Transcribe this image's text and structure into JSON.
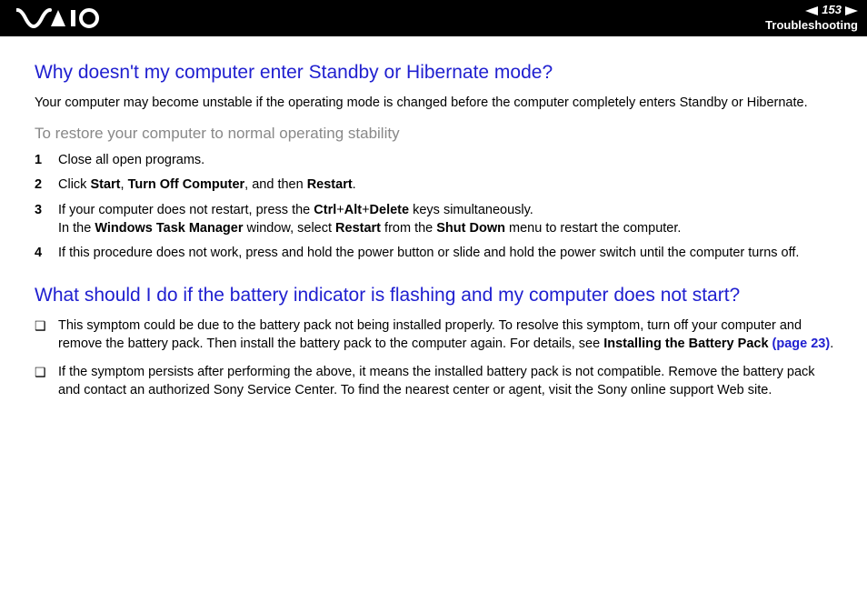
{
  "header": {
    "page_number": "153",
    "section": "Troubleshooting"
  },
  "q1": {
    "heading": "Why doesn't my computer enter Standby or Hibernate mode?",
    "intro": "Your computer may become unstable if the operating mode is changed before the computer completely enters Standby or Hibernate.",
    "sub": "To restore your computer to normal operating stability",
    "steps": {
      "s1": "Close all open programs.",
      "s2_a": "Click ",
      "s2_b": "Start",
      "s2_c": ", ",
      "s2_d": "Turn Off Computer",
      "s2_e": ", and then ",
      "s2_f": "Restart",
      "s2_g": ".",
      "s3_a": "If your computer does not restart, press the ",
      "s3_b": "Ctrl",
      "s3_c": "+",
      "s3_d": "Alt",
      "s3_e": "+",
      "s3_f": "Delete",
      "s3_g": " keys simultaneously.",
      "s3_h": "In the ",
      "s3_i": "Windows Task Manager",
      "s3_j": " window, select ",
      "s3_k": "Restart",
      "s3_l": " from the ",
      "s3_m": "Shut Down",
      "s3_n": " menu to restart the computer.",
      "s4": "If this procedure does not work, press and hold the power button or slide and hold the power switch until the computer turns off."
    }
  },
  "q2": {
    "heading": "What should I do if the battery indicator is flashing and my computer does not start?",
    "b1_a": "This symptom could be due to the battery pack not being installed properly. To resolve this symptom, turn off your computer and remove the battery pack. Then install the battery pack to the computer again. For details, see ",
    "b1_b": "Installing the Battery Pack ",
    "b1_c": "(page 23)",
    "b1_d": ".",
    "b2": "If the symptom persists after performing the above, it means the installed battery pack is not compatible. Remove the battery pack and contact an authorized Sony Service Center. To find the nearest center or agent, visit the Sony online support Web site."
  },
  "labels": {
    "n1": "1",
    "n2": "2",
    "n3": "3",
    "n4": "4",
    "bullet": "❑"
  }
}
